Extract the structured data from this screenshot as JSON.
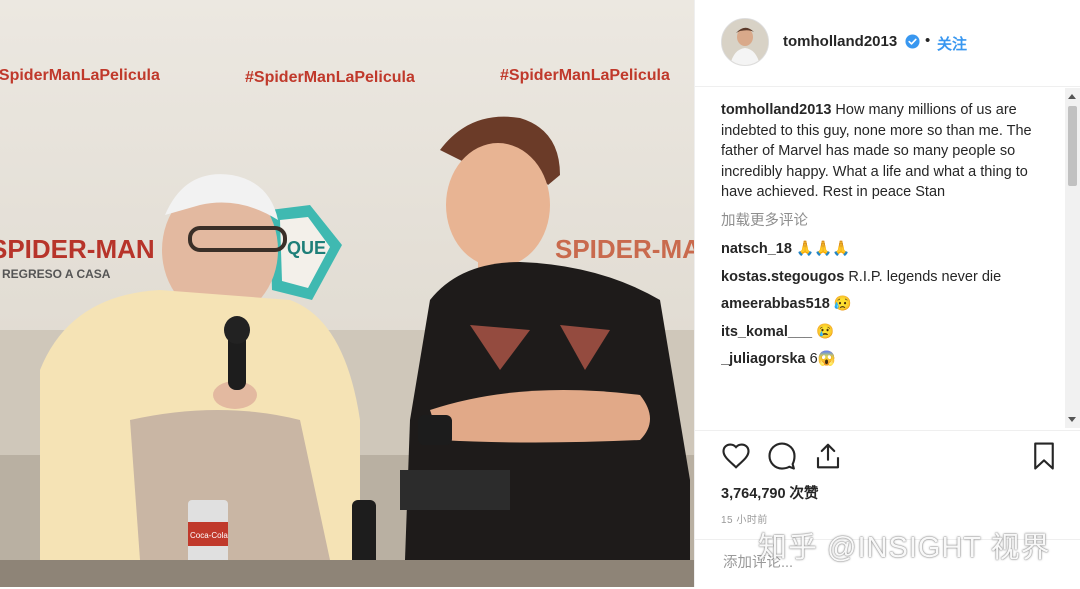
{
  "post": {
    "username": "tomholland2013",
    "separator": "•",
    "follow_label": "关注",
    "caption_user": "tomholland2013",
    "caption_text": "How many millions of us are indebted to this guy, none more so than me. The father of Marvel has made so many people so incredibly happy. What a life and what a thing to have achieved. Rest in peace Stan",
    "load_more": "加载更多评论",
    "comments": [
      {
        "user": "natsch_18",
        "text": "🙏🙏🙏"
      },
      {
        "user": "kostas.stegougos",
        "text": "R.I.P. legends never die"
      },
      {
        "user": "ameerabbas518",
        "text": "😥"
      },
      {
        "user": "its_komal___",
        "text": "😢"
      },
      {
        "user": "_juliagorska",
        "text": "6😱"
      }
    ],
    "likes": "3,764,790 次赞",
    "time": "15 小时前",
    "add_comment_placeholder": "添加评论..."
  },
  "photo": {
    "banner_hashtag": "#SpiderManLaPelicula",
    "movie_title": "SPIDER-MAN",
    "movie_subtitle": "REGRESO A CASA",
    "sign_text": "QUE",
    "cup_text": "Coca-Cola"
  },
  "watermark": "知乎 @INSIGHT 视界",
  "icons": {
    "verified": "verified-badge-icon",
    "like": "heart-icon",
    "comment": "comment-bubble-icon",
    "share": "share-icon",
    "save": "bookmark-icon"
  },
  "colors": {
    "accent": "#3897f0",
    "text": "#262626",
    "muted": "#8e8e8e"
  }
}
